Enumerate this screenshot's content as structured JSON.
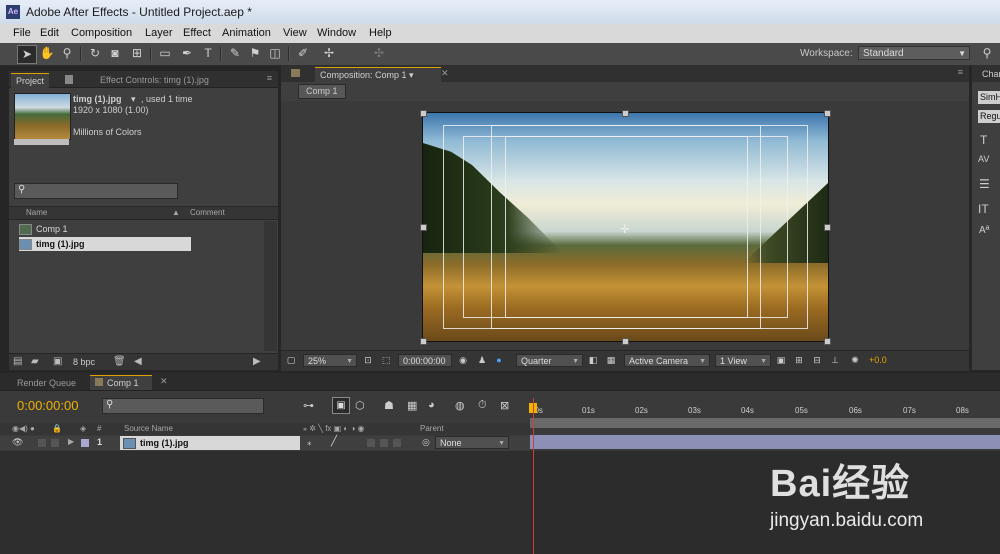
{
  "window": {
    "app_icon": "Ae",
    "title": "Adobe After Effects - Untitled Project.aep *"
  },
  "menu": [
    "File",
    "Edit",
    "Composition",
    "Layer",
    "Effect",
    "Animation",
    "View",
    "Window",
    "Help"
  ],
  "workspace": {
    "label": "Workspace:",
    "value": "Standard"
  },
  "project_panel": {
    "tab_project": "Project",
    "tab_effect_controls": "Effect Controls: timg (1).jpg",
    "selected_name": "timg (1).jpg",
    "used": ", used 1 time",
    "dimensions": "1920 x 1080 (1.00)",
    "colors": "Millions of Colors",
    "columns": {
      "name": "Name",
      "comment": "Comment"
    },
    "items": [
      "Comp 1",
      "timg (1).jpg"
    ],
    "bpc": "8 bpc"
  },
  "composition_panel": {
    "tab": "Composition: Comp 1",
    "subtab": "Comp 1",
    "zoom": "25%",
    "timecode": "0:00:00:00",
    "resolution": "Quarter",
    "camera": "Active Camera",
    "views": "1 View",
    "exposure": "+0.0"
  },
  "character_panel": {
    "tab": "Char",
    "font": "SimH",
    "style": "Regu"
  },
  "timeline": {
    "tab_render_queue": "Render Queue",
    "tab_comp": "Comp 1",
    "timecode": "0:00:00:00",
    "columns": {
      "num": "#",
      "source": "Source Name",
      "parent": "Parent"
    },
    "layer": {
      "num": "1",
      "name": "timg (1).jpg",
      "parent": "None"
    },
    "ruler": [
      "00s",
      "01s",
      "02s",
      "03s",
      "04s",
      "05s",
      "06s",
      "07s",
      "08s"
    ]
  },
  "watermark": {
    "logo": "Bai经验",
    "url": "jingyan.baidu.com"
  }
}
